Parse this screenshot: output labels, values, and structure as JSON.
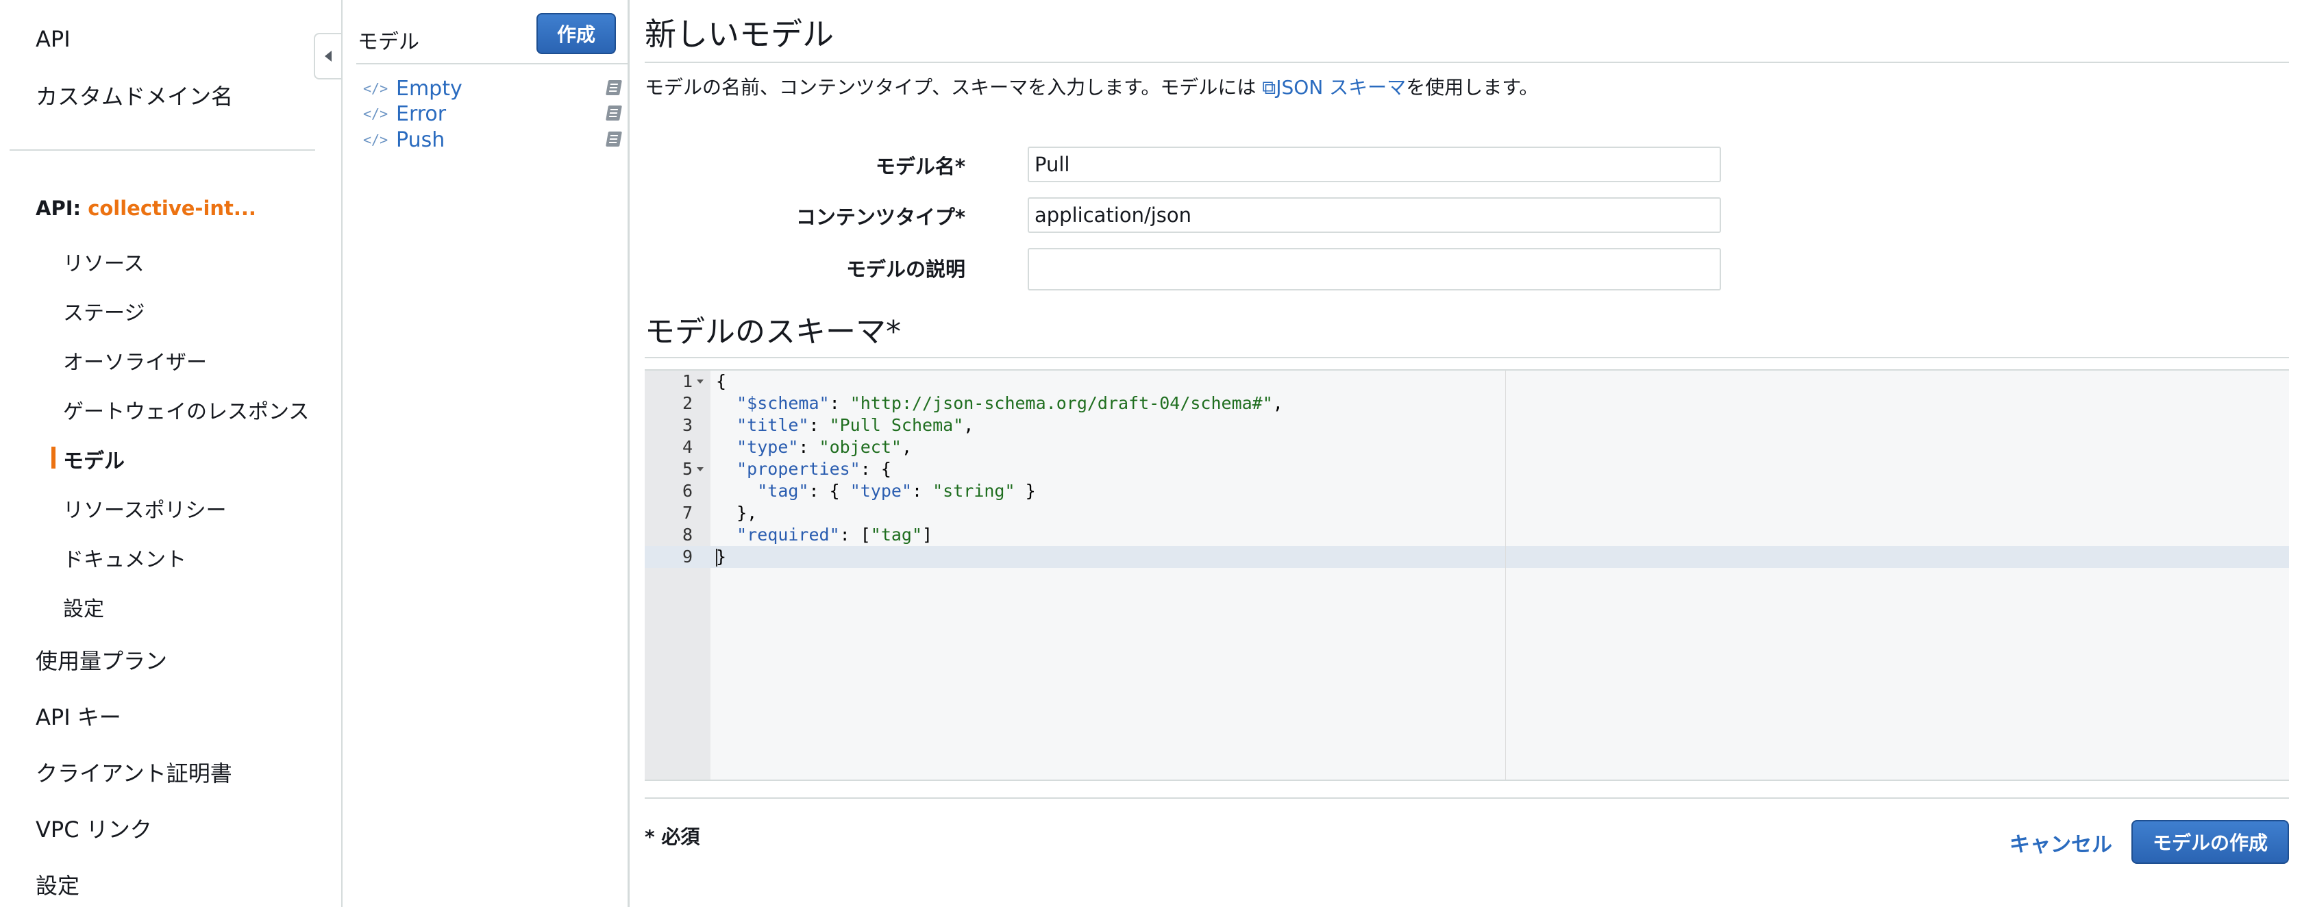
{
  "nav": {
    "api_label": "API",
    "custom_domain": "カスタムドメイン名",
    "api_prefix": "API: ",
    "api_name": "collective-int...",
    "sub_items": [
      "リソース",
      "ステージ",
      "オーソライザー",
      "ゲートウェイのレスポンス",
      "モデル",
      "リソースポリシー",
      "ドキュメント",
      "設定"
    ],
    "bottom_items": [
      "使用量プラン",
      "API キー",
      "クライアント証明書",
      "VPC リンク",
      "設定"
    ]
  },
  "models_panel": {
    "title": "モデル",
    "create_label": "作成",
    "items": [
      "Empty",
      "Error",
      "Push"
    ]
  },
  "main": {
    "title": "新しいモデル",
    "intro_before": "モデルの名前、コンテンツタイプ、スキーマを入力します。モデルには ",
    "intro_link": "JSON スキーマ",
    "intro_after": "を使用します。",
    "form": {
      "name_label": "モデル名*",
      "name_value": "Pull",
      "content_type_label": "コンテンツタイプ*",
      "content_type_value": "application/json",
      "description_label": "モデルの説明",
      "description_value": ""
    },
    "schema_heading": "モデルのスキーマ*",
    "required_note": "* 必須",
    "cancel_label": "キャンセル",
    "submit_label": "モデルの作成"
  },
  "editor": {
    "line_numbers": [
      "1",
      "2",
      "3",
      "4",
      "5",
      "6",
      "7",
      "8",
      "9"
    ],
    "lines": [
      "{",
      "  \"$schema\": \"http://json-schema.org/draft-04/schema#\",",
      "  \"title\": \"Pull Schema\",",
      "  \"type\": \"object\",",
      "  \"properties\": {",
      "    \"tag\": { \"type\": \"string\" }",
      "  },",
      "  \"required\": [\"tag\"]",
      "}"
    ]
  },
  "colors": {
    "accent_orange": "#ec7211",
    "link_blue": "#2a6bbf",
    "primary_button": "#2a64b3"
  }
}
